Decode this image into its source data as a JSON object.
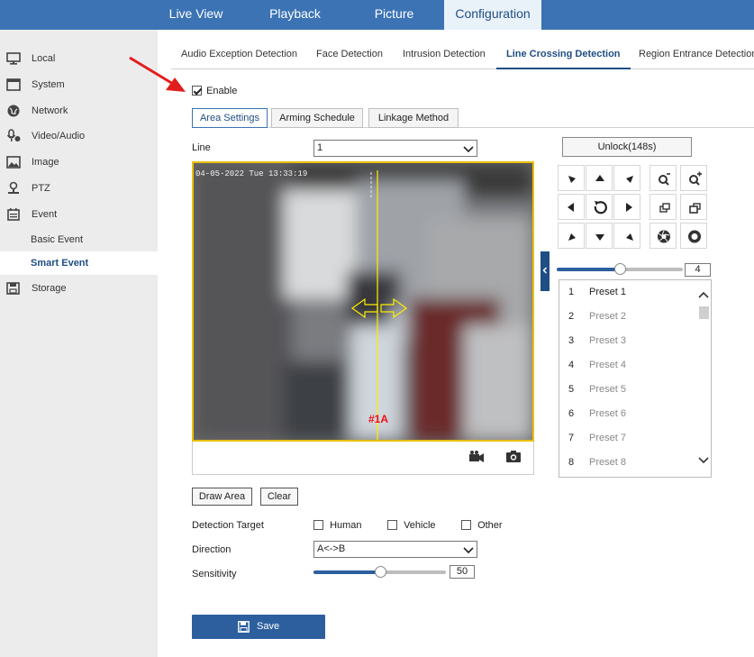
{
  "topnav": {
    "items": [
      {
        "label": "Live View",
        "active": false
      },
      {
        "label": "Playback",
        "active": false
      },
      {
        "label": "Picture",
        "active": false
      },
      {
        "label": "Configuration",
        "active": true
      }
    ]
  },
  "sidebar": {
    "items": [
      {
        "label": "Local",
        "icon": "monitor-icon"
      },
      {
        "label": "System",
        "icon": "system-icon"
      },
      {
        "label": "Network",
        "icon": "globe-icon"
      },
      {
        "label": "Video/Audio",
        "icon": "microphone-icon"
      },
      {
        "label": "Image",
        "icon": "image-icon"
      },
      {
        "label": "PTZ",
        "icon": "ptz-icon"
      },
      {
        "label": "Event",
        "icon": "calendar-icon"
      }
    ],
    "sub_items": [
      {
        "label": "Basic Event",
        "active": false
      },
      {
        "label": "Smart Event",
        "active": true
      }
    ],
    "storage": {
      "label": "Storage",
      "icon": "storage-icon"
    }
  },
  "detection_tabs": [
    {
      "label": "Audio Exception Detection",
      "active": false
    },
    {
      "label": "Face Detection",
      "active": false
    },
    {
      "label": "Intrusion Detection",
      "active": false
    },
    {
      "label": "Line Crossing Detection",
      "active": true
    },
    {
      "label": "Region Entrance Detection",
      "active": false
    }
  ],
  "enable": {
    "label": "Enable",
    "checked": true
  },
  "sub_tabs": [
    {
      "label": "Area Settings",
      "active": true
    },
    {
      "label": "Arming Schedule",
      "active": false
    },
    {
      "label": "Linkage Method",
      "active": false
    }
  ],
  "line": {
    "label": "Line",
    "value": "1"
  },
  "video": {
    "timestamp": "04-05-2022 Tue 13:33:19",
    "line_tag": "#1A"
  },
  "ptz": {
    "unlock_label": "Unlock(148s)",
    "speed_value": "4",
    "speed_fraction": 0.5,
    "presets": [
      {
        "num": "1",
        "name": "Preset 1"
      },
      {
        "num": "2",
        "name": "Preset 2"
      },
      {
        "num": "3",
        "name": "Preset 3"
      },
      {
        "num": "4",
        "name": "Preset 4"
      },
      {
        "num": "5",
        "name": "Preset 5"
      },
      {
        "num": "6",
        "name": "Preset 6"
      },
      {
        "num": "7",
        "name": "Preset 7"
      },
      {
        "num": "8",
        "name": "Preset 8"
      }
    ]
  },
  "actions": {
    "draw_area": "Draw Area",
    "clear": "Clear",
    "save": "Save"
  },
  "detection_target": {
    "label": "Detection Target",
    "options": [
      {
        "label": "Human",
        "checked": false
      },
      {
        "label": "Vehicle",
        "checked": false
      },
      {
        "label": "Other",
        "checked": false
      }
    ]
  },
  "direction": {
    "label": "Direction",
    "value": "A<->B"
  },
  "sensitivity": {
    "label": "Sensitivity",
    "value": "50",
    "fraction": 0.5
  },
  "colors": {
    "nav_blue": "#3b73b4",
    "accent": "#1f4e85",
    "save_blue": "#2d5f9e",
    "line_yellow": "#e8c000"
  }
}
